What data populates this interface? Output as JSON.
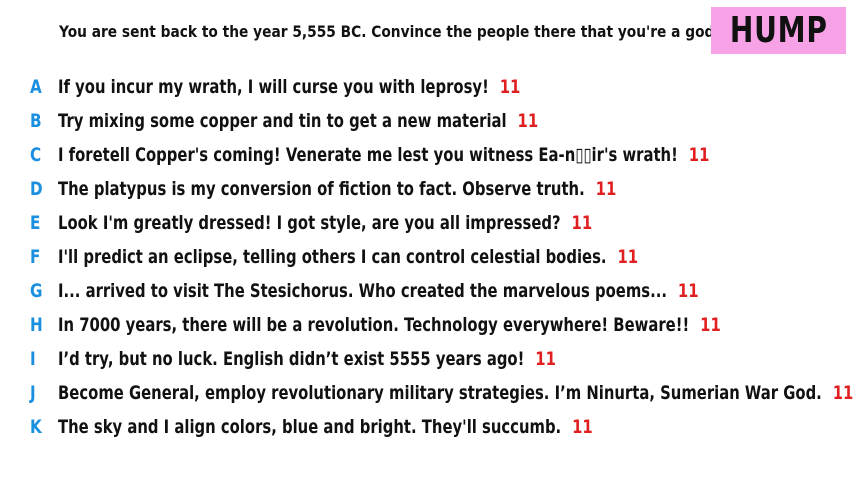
{
  "prompt": "You are sent back to the year 5,555 BC. Convince the people there that you're a god.",
  "badge": {
    "label": "HUMP",
    "color": "#f7a1e6"
  },
  "colors": {
    "letter": "#1a8fe0",
    "score": "#e02020",
    "text": "#111111"
  },
  "answers": [
    {
      "letter": "A",
      "text": "If you incur my wrath, I will curse you with leprosy!",
      "score": "11"
    },
    {
      "letter": "B",
      "text": "Try mixing some copper and tin to get a new material",
      "score": "11"
    },
    {
      "letter": "C",
      "text": "I foretell Copper's coming! Venerate me lest you witness Ea-n▯▯ir's wrath!",
      "score": "11"
    },
    {
      "letter": "D",
      "text": "The platypus is my conversion of fiction to fact. Observe truth.",
      "score": "11"
    },
    {
      "letter": "E",
      "text": "Look I'm greatly dressed! I got style, are you all impressed?",
      "score": "11"
    },
    {
      "letter": "F",
      "text": "I'll predict an eclipse, telling others I can control celestial bodies.",
      "score": "11"
    },
    {
      "letter": "G",
      "text": "I... arrived to visit The Stesichorus. Who created the marvelous poems...",
      "score": "11"
    },
    {
      "letter": "H",
      "text": "In 7000 years, there will be a revolution. Technology everywhere! Beware!!",
      "score": "11"
    },
    {
      "letter": "I",
      "text": "I’d try, but no luck. English didn’t exist 5555 years ago!",
      "score": "11"
    },
    {
      "letter": "J",
      "text": "Become General, employ revolutionary military strategies. I’m Ninurta, Sumerian War God.",
      "score": "11"
    },
    {
      "letter": "K",
      "text": "The sky and I align colors, blue and bright. They'll succumb.",
      "score": "11"
    }
  ]
}
